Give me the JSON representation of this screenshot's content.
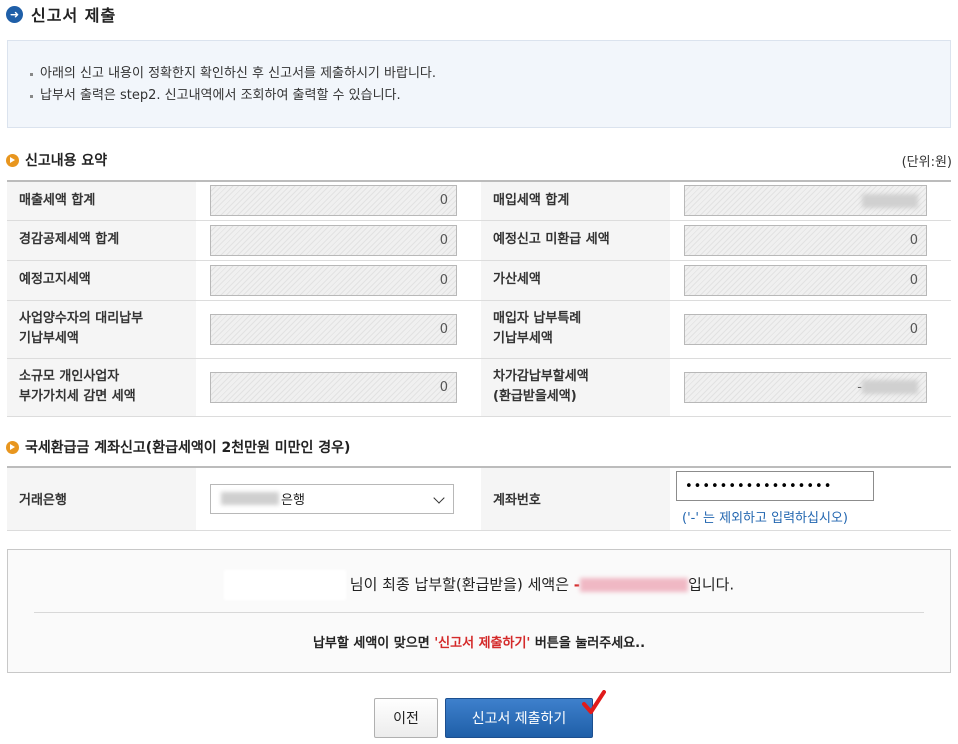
{
  "header": {
    "title": "신고서 제출"
  },
  "notice": {
    "items": [
      "아래의 신고 내용이 정확한지 확인하신 후 신고서를 제출하시기 바랍니다.",
      "납부서 출력은 step2. 신고내역에서 조회하여 출력할 수 있습니다."
    ]
  },
  "summary": {
    "heading": "신고내용 요약",
    "unit": "(단위:원)",
    "rows": [
      {
        "left_label": "매출세액 합계",
        "left_value": "0",
        "right_label": "매입세액 합계",
        "right_value": ""
      },
      {
        "left_label": "경감공제세액 합계",
        "left_value": "0",
        "right_label": "예정신고 미환급 세액",
        "right_value": "0"
      },
      {
        "left_label": "예정고지세액",
        "left_value": "0",
        "right_label": "가산세액",
        "right_value": "0"
      },
      {
        "left_label": "사업양수자의 대리납부\n기납부세액",
        "left_value": "0",
        "right_label": "매입자 납부특례\n기납부세액",
        "right_value": "0"
      },
      {
        "left_label": "소규모 개인사업자\n부가가치세 감면 세액",
        "left_value": "0",
        "right_label": "차가감납부할세액\n(환급받을세액)",
        "right_value": "-"
      }
    ]
  },
  "account": {
    "heading": "국세환급금 계좌신고(환급세액이 2천만원 미만인 경우)",
    "bank_label": "거래은행",
    "bank_value": "은행",
    "account_label": "계좌번호",
    "account_value": "•••••••••••••••••",
    "hint": "('-' 는 제외하고 입력하십시오)"
  },
  "confirm": {
    "line1_prefix": "님이 최종 납부할(환급받을) 세액은 ",
    "line1_amount": "-",
    "line1_suffix": "입니다.",
    "line2_prefix": "납부할 세액이 맞으면 ",
    "line2_highlight": "'신고서 제출하기'",
    "line2_suffix": " 버튼을 눌러주세요.."
  },
  "buttons": {
    "prev": "이전",
    "submit": "신고서 제출하기"
  },
  "colors": {
    "accent": "#1f5fa8",
    "highlight_red": "#d42a2a",
    "hint_blue": "#2266b0",
    "section_orange": "#e8961f"
  }
}
